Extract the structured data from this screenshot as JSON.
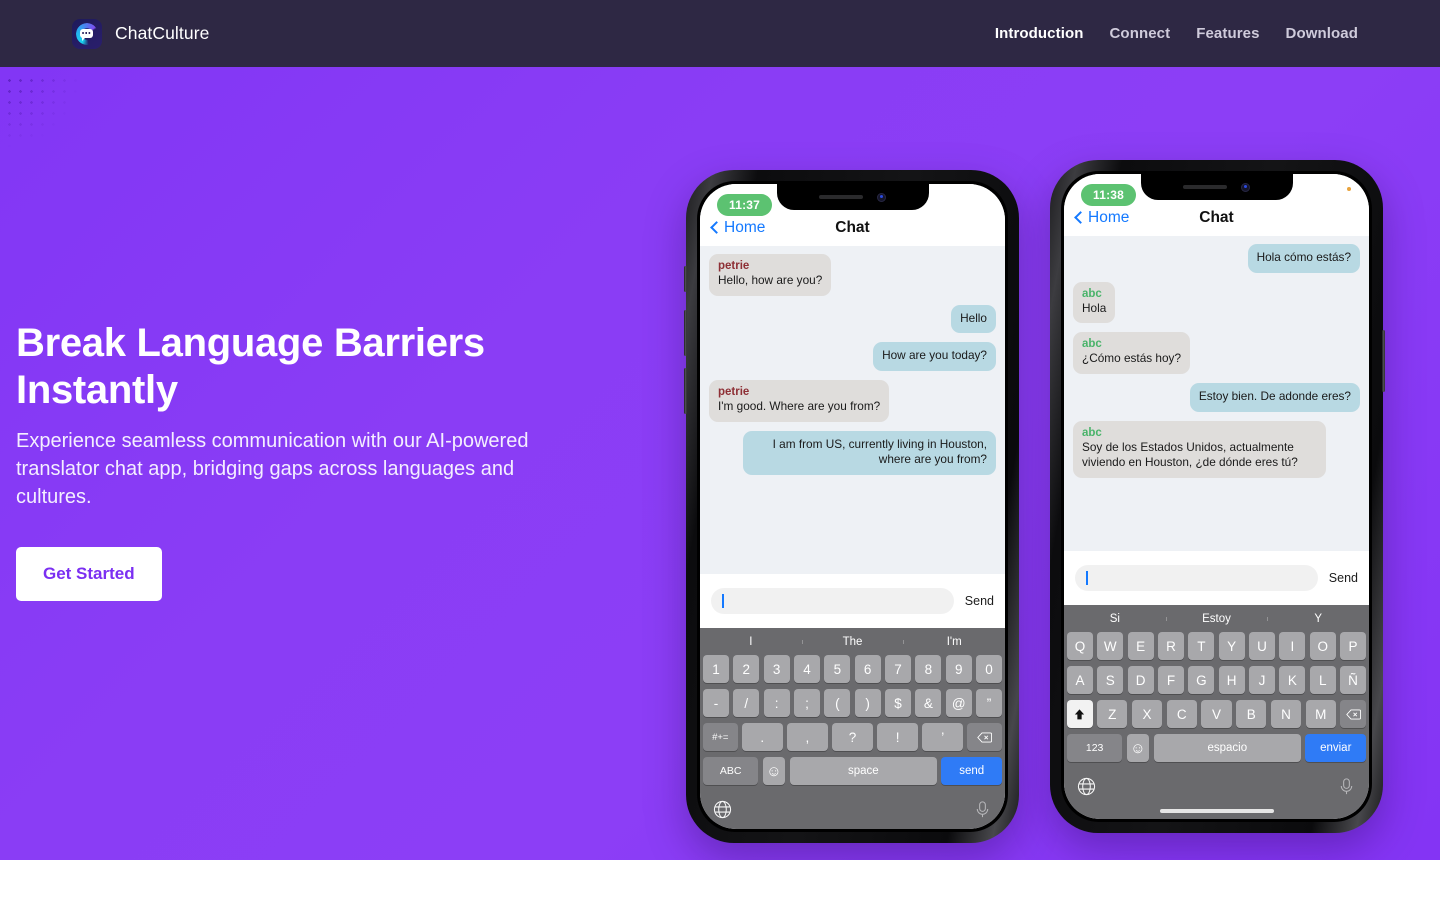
{
  "header": {
    "brand": {
      "name": "ChatCulture",
      "logo_icon": "chatculture-logo-icon"
    },
    "nav": [
      {
        "label": "Introduction",
        "active": true
      },
      {
        "label": "Connect",
        "active": false
      },
      {
        "label": "Features",
        "active": false
      },
      {
        "label": "Download",
        "active": false
      }
    ],
    "bg_color": "#2e2844"
  },
  "hero": {
    "title_line1": "Break Language Barriers",
    "title_line2": "Instantly",
    "subtitle": "Experience seamless communication with our AI-powered translator chat app, bridging gaps across languages and cultures.",
    "cta_label": "Get Started",
    "accent_color": "#8a3df5",
    "cta_text_color": "#7b2ff2"
  },
  "phones": [
    {
      "status_time": "11:37",
      "nav_back": "Home",
      "nav_title": "Chat",
      "messages": [
        {
          "dir": "in",
          "sender": "petrie",
          "sender_color": "red",
          "text": "Hello, how are you?"
        },
        {
          "dir": "out",
          "sender": "",
          "sender_color": "",
          "text": "Hello"
        },
        {
          "dir": "out",
          "sender": "",
          "sender_color": "",
          "text": "How are you today?"
        },
        {
          "dir": "in",
          "sender": "petrie",
          "sender_color": "red",
          "text": "I'm good. Where are you from?"
        },
        {
          "dir": "out",
          "sender": "",
          "sender_color": "",
          "text": "I am from US, currently living in Houston, where are you from?"
        }
      ],
      "composer": {
        "value": "",
        "send_label": "Send"
      },
      "keyboard": {
        "suggestions": [
          "I",
          "The",
          "I'm"
        ],
        "row1": [
          "1",
          "2",
          "3",
          "4",
          "5",
          "6",
          "7",
          "8",
          "9",
          "0"
        ],
        "row2": [
          "-",
          "/",
          ":",
          ";",
          "(",
          ")",
          "$",
          "&",
          "@",
          "”"
        ],
        "row3_left": "#+=",
        "row3": [
          ".",
          ",",
          "?",
          "!",
          "’"
        ],
        "row3_right": "backspace-icon",
        "row4_abc": "ABC",
        "row4_emoji": "emoji-icon",
        "row4_space": "space",
        "row4_send": "send",
        "globe_icon": "globe-icon",
        "mic_icon": "microphone-icon"
      },
      "show_home_indicator": false
    },
    {
      "status_time": "11:38",
      "nav_back": "Home",
      "nav_title": "Chat",
      "messages": [
        {
          "dir": "out",
          "sender": "",
          "sender_color": "",
          "text": "Hola cómo estás?"
        },
        {
          "dir": "in",
          "sender": "abc",
          "sender_color": "green",
          "text": "Hola"
        },
        {
          "dir": "in",
          "sender": "abc",
          "sender_color": "green",
          "text": "¿Cómo estás hoy?"
        },
        {
          "dir": "out",
          "sender": "",
          "sender_color": "",
          "text": "Estoy bien. De adonde eres?"
        },
        {
          "dir": "in",
          "sender": "abc",
          "sender_color": "green",
          "text": "Soy de los Estados Unidos, actualmente viviendo en Houston, ¿de dónde eres tú?"
        }
      ],
      "composer": {
        "value": "",
        "send_label": "Send"
      },
      "keyboard": {
        "suggestions": [
          "Si",
          "Estoy",
          "Y"
        ],
        "row1": [
          "Q",
          "W",
          "E",
          "R",
          "T",
          "Y",
          "U",
          "I",
          "O",
          "P"
        ],
        "row2": [
          "A",
          "S",
          "D",
          "F",
          "G",
          "H",
          "J",
          "K",
          "L",
          "Ñ"
        ],
        "row3_left": "shift-icon",
        "row3": [
          "Z",
          "X",
          "C",
          "V",
          "B",
          "N",
          "M"
        ],
        "row3_right": "backspace-icon",
        "row4_abc": "123",
        "row4_emoji": "emoji-icon",
        "row4_space": "espacio",
        "row4_send": "enviar",
        "globe_icon": "globe-icon",
        "mic_icon": "microphone-icon"
      },
      "show_home_indicator": true
    }
  ]
}
